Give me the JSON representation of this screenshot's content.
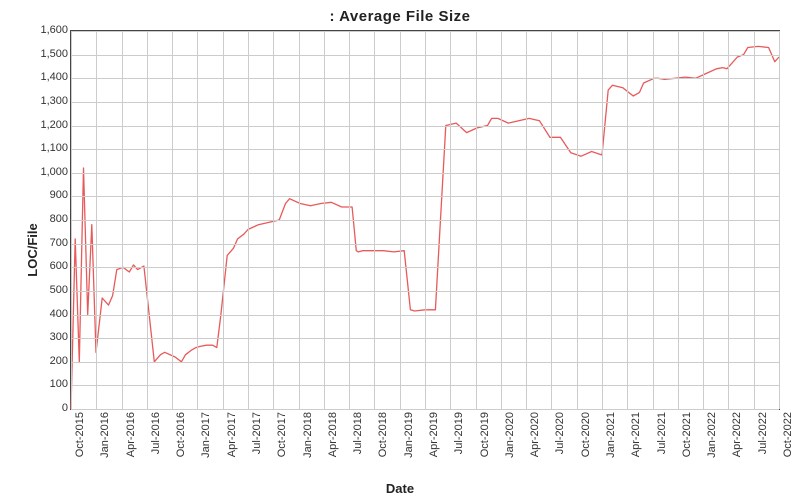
{
  "chart_data": {
    "type": "line",
    "title": ": Average File Size",
    "xlabel": "Date",
    "ylabel": "LOC/File",
    "ylim": [
      0,
      1600
    ],
    "y_ticks": [
      0,
      100,
      200,
      300,
      400,
      500,
      600,
      700,
      800,
      900,
      1000,
      1100,
      1200,
      1300,
      1400,
      1500,
      1600
    ],
    "y_tick_labels": [
      "0",
      "100",
      "200",
      "300",
      "400",
      "500",
      "600",
      "700",
      "800",
      "900",
      "1,000",
      "1,100",
      "1,200",
      "1,300",
      "1,400",
      "1,500",
      "1,600"
    ],
    "x_tick_labels": [
      "Oct-2015",
      "Jan-2016",
      "Apr-2016",
      "Jul-2016",
      "Oct-2016",
      "Jan-2017",
      "Apr-2017",
      "Jul-2017",
      "Oct-2017",
      "Jan-2018",
      "Apr-2018",
      "Jul-2018",
      "Oct-2018",
      "Jan-2019",
      "Apr-2019",
      "Jul-2019",
      "Oct-2019",
      "Jan-2020",
      "Apr-2020",
      "Jul-2020",
      "Oct-2020",
      "Jan-2021",
      "Apr-2021",
      "Jul-2021",
      "Oct-2021",
      "Jan-2022",
      "Apr-2022",
      "Jul-2022",
      "Oct-2022"
    ],
    "line_color": "#e85a5a",
    "x": [
      0,
      0.2,
      0.4,
      0.6,
      0.8,
      1.0,
      1.2,
      1.5,
      1.8,
      2.0,
      2.2,
      2.5,
      2.8,
      3.0,
      3.2,
      3.5,
      4.0,
      4.3,
      4.5,
      5.0,
      5.3,
      5.5,
      5.8,
      6.0,
      6.2,
      6.5,
      6.8,
      7.0,
      7.2,
      7.5,
      7.8,
      8.0,
      8.3,
      8.5,
      9.0,
      9.5,
      10.0,
      10.3,
      10.5,
      11.0,
      11.5,
      12.0,
      12.5,
      13.0,
      13.5,
      13.7,
      13.8,
      14.0,
      14.5,
      15.0,
      15.5,
      16.0,
      16.3,
      16.5,
      17.0,
      17.5,
      18.0,
      18.5,
      19.0,
      19.5,
      20.0,
      20.2,
      20.5,
      21.0,
      21.5,
      22.0,
      22.5,
      23.0,
      23.5,
      24.0,
      24.5,
      25.0,
      25.5,
      25.8,
      26.0,
      26.5,
      27.0,
      27.3,
      27.5,
      28.0
    ],
    "values": [
      0,
      720,
      200,
      1020,
      400,
      780,
      240,
      470,
      440,
      480,
      590,
      600,
      580,
      610,
      590,
      605,
      200,
      230,
      240,
      220,
      200,
      230,
      250,
      260,
      265,
      270,
      270,
      260,
      400,
      650,
      680,
      720,
      740,
      760,
      780,
      790,
      800,
      870,
      890,
      870,
      860,
      870,
      875,
      855,
      855,
      670,
      665,
      670,
      670,
      670,
      665,
      670,
      420,
      415,
      420,
      420,
      1200,
      1210,
      1170,
      1190,
      1200,
      1230,
      1230,
      1210,
      1220,
      1230,
      1220,
      1150,
      1150,
      1085,
      1070,
      1090,
      1075,
      1350,
      1370,
      1360,
      1325,
      1340,
      1380,
      1400
    ],
    "x2": [
      28.0,
      28.2,
      28.5,
      29.0,
      29.5,
      30.0,
      30.5,
      31.0,
      31.3,
      31.5,
      32.0,
      32.3,
      32.5,
      33.0,
      33.5,
      33.8,
      34.0
    ],
    "values2": [
      1400,
      1400,
      1395,
      1400,
      1405,
      1400,
      1420,
      1440,
      1445,
      1440,
      1490,
      1500,
      1530,
      1535,
      1530,
      1470,
      1490
    ],
    "x_domain": [
      0,
      34
    ]
  }
}
